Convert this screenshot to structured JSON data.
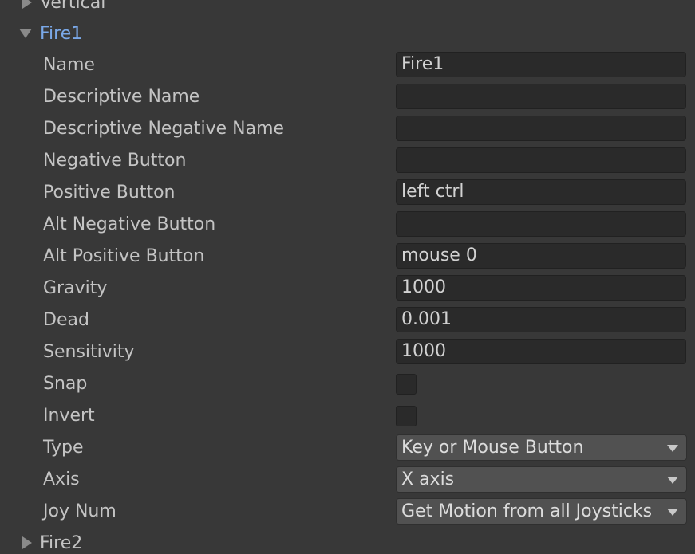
{
  "axes": {
    "vertical": {
      "label": "Vertical",
      "expanded": false
    },
    "fire1": {
      "label": "Fire1",
      "expanded": true
    },
    "fire2": {
      "label": "Fire2",
      "expanded": false
    }
  },
  "fields": {
    "name": {
      "label": "Name",
      "value": "Fire1"
    },
    "descriptive_name": {
      "label": "Descriptive Name",
      "value": ""
    },
    "descriptive_negative_name": {
      "label": "Descriptive Negative Name",
      "value": ""
    },
    "negative_button": {
      "label": "Negative Button",
      "value": ""
    },
    "positive_button": {
      "label": "Positive Button",
      "value": "left ctrl"
    },
    "alt_negative_button": {
      "label": "Alt Negative Button",
      "value": ""
    },
    "alt_positive_button": {
      "label": "Alt Positive Button",
      "value": "mouse 0"
    },
    "gravity": {
      "label": "Gravity",
      "value": "1000"
    },
    "dead": {
      "label": "Dead",
      "value": "0.001"
    },
    "sensitivity": {
      "label": "Sensitivity",
      "value": "1000"
    },
    "snap": {
      "label": "Snap",
      "checked": false
    },
    "invert": {
      "label": "Invert",
      "checked": false
    },
    "type": {
      "label": "Type",
      "value": "Key or Mouse Button"
    },
    "axis": {
      "label": "Axis",
      "value": "X axis"
    },
    "joy_num": {
      "label": "Joy Num",
      "value": "Get Motion from all Joysticks"
    }
  },
  "icons": {
    "collapsed": "triangle-right-icon",
    "expanded": "triangle-down-icon",
    "dropdown": "chevron-down-icon"
  },
  "colors": {
    "background": "#383838",
    "expanded_header": "#7aa8e8",
    "field_background": "#2a2a2a",
    "dropdown_background": "#515151"
  }
}
